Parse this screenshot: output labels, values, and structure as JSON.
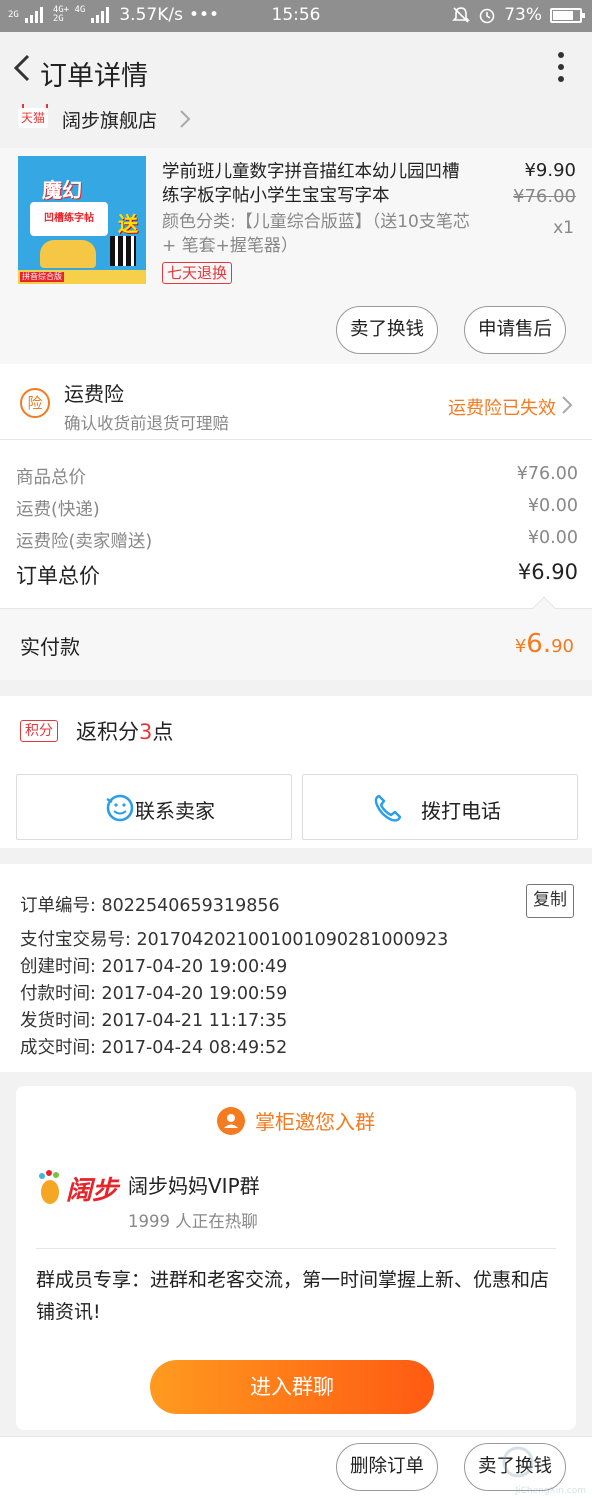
{
  "status_bar": {
    "signal_left": "2G",
    "signal_mid": "4G+ 4G\n2G",
    "speed": "3.57K/s",
    "dots": "•••",
    "time": "15:56",
    "battery": "73%",
    "battery_level": 0.73
  },
  "nav": {
    "title": "订单详情"
  },
  "shop": {
    "badge": "天猫",
    "name": "阔步旗舰店"
  },
  "product": {
    "image": {
      "title": "魔幻",
      "subtitle": "凹槽练字帖",
      "send": "送",
      "tag": "拼音综合版"
    },
    "title": "学前班儿童数字拼音描红本幼儿园凹槽练字板字帖小学生宝宝写字本",
    "spec": "颜色分类:【儿童综合版蓝】（送10支笔芯+ 笔套+握笔器）",
    "return_badge": "七天退换",
    "price": "¥9.90",
    "original_price": "¥76.00",
    "quantity": "x1",
    "sell_button": "卖了换钱",
    "aftersale_button": "申请售后"
  },
  "insurance": {
    "badge": "险",
    "title": "运费险",
    "subtitle": "确认收货前退货可理赔",
    "status": "运费险已失效"
  },
  "totals": [
    {
      "label": "商品总价",
      "value": "¥76.00"
    },
    {
      "label": "运费(快递)",
      "value": "¥0.00"
    },
    {
      "label": "运费险(卖家赠送)",
      "value": "¥0.00"
    },
    {
      "label": "订单总价",
      "value": "¥6.90"
    }
  ],
  "paid": {
    "label": "实付款",
    "currency": "¥",
    "integer": "6.",
    "decimal": "90"
  },
  "points": {
    "badge": "积分",
    "prefix": "返积分",
    "count": "3",
    "suffix": "点"
  },
  "contact": {
    "seller": "联系卖家",
    "phone": "拨打电话"
  },
  "order_info": {
    "copy_button": "复制",
    "lines": [
      "订单编号: 8022540659319856",
      "支付宝交易号: 2017042021001001090281000923",
      "创建时间: 2017-04-20 19:00:49",
      "付款时间: 2017-04-20 19:00:59",
      "发货时间: 2017-04-21 11:17:35",
      "成交时间: 2017-04-24 08:49:52"
    ]
  },
  "group": {
    "header": "掌柜邀您入群",
    "logo_text": "阔步",
    "name": "阔步妈妈VIP群",
    "online": "1999 人正在热聊",
    "description": "群成员专享：进群和老客交流，第一时间掌握上新、优惠和店铺资讯!",
    "join_button": "进入群聊"
  },
  "bottom_bar": {
    "delete_button": "删除订单",
    "sell_button": "卖了换钱"
  },
  "watermark": {
    "text": "JiChengXin.com"
  },
  "colors": {
    "accent_orange": "#f47b20",
    "tmall_red": "#e4393c",
    "status_bar_gray": "#8f8f8f"
  }
}
